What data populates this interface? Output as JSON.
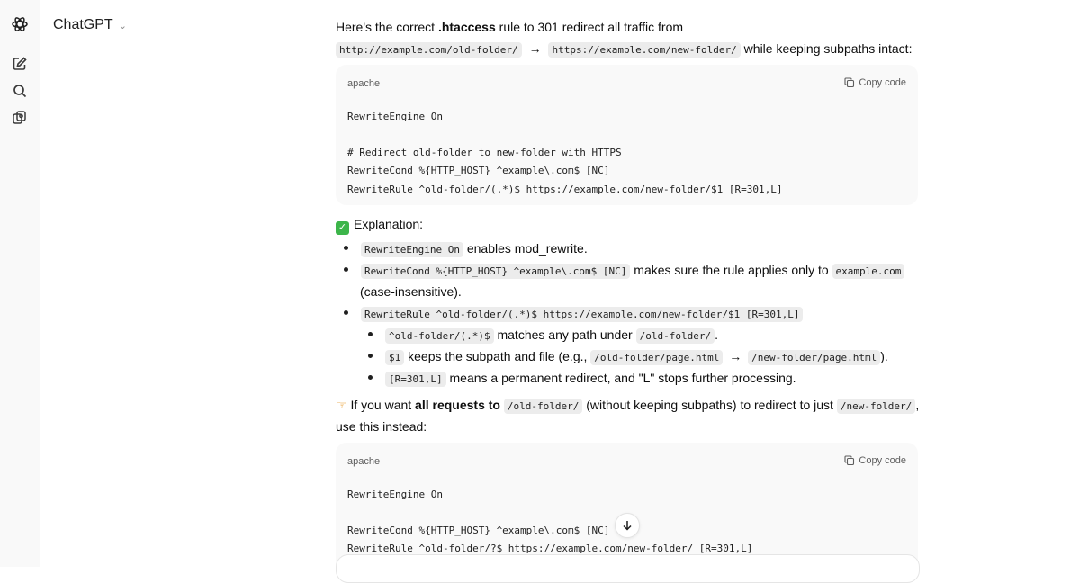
{
  "header": {
    "model_name": "ChatGPT"
  },
  "sidebar": {
    "icons": [
      "openai-logo-icon",
      "new-chat-icon",
      "search-icon",
      "gpts-icon"
    ]
  },
  "message": {
    "intro_1": "Here's the correct ",
    "intro_bold": ".htaccess",
    "intro_2": " rule to 301 redirect all traffic from",
    "from_url": "http://example.com/old-folder/",
    "arrow": "→",
    "to_url": "https://example.com/new-folder/",
    "intro_3": " while keeping subpaths intact:",
    "code1": {
      "lang": "apache",
      "copy_label": "Copy code",
      "lines": [
        "RewriteEngine On",
        "# Redirect old-folder to new-folder with HTTPS",
        "RewriteCond %{HTTP_HOST} ^example\\.com$ [NC]",
        "RewriteRule ^old-folder/(.*)$ https://example.com/new-folder/$1 [R=301,L]"
      ]
    },
    "explanation_heading": "Explanation:",
    "bullets": {
      "b1_code": "RewriteEngine On",
      "b1_text": " enables mod_rewrite.",
      "b2_code": "RewriteCond %{HTTP_HOST} ^example\\.com$ [NC]",
      "b2_text": " makes sure the rule applies only to ",
      "b2_code2": "example.com",
      "b2_text2": "(case-insensitive).",
      "b3_code": "RewriteRule ^old-folder/(.*)$ https://example.com/new-folder/$1 [R=301,L]",
      "s1_code": "^old-folder/(.*)$",
      "s1_text": " matches any path under ",
      "s1_code2": "/old-folder/",
      "s1_end": ".",
      "s2_code": "$1",
      "s2_text": " keeps the subpath and file (e.g., ",
      "s2_code2": "/old-folder/page.html",
      "s2_arrow": "→",
      "s2_code3": "/new-folder/page.html",
      "s2_end": ").",
      "s3_code": "[R=301,L]",
      "s3_text": " means a permanent redirect, and \"L\" stops further processing."
    },
    "tip": {
      "t1": " If you want ",
      "bold": "all requests to",
      "code1": "/old-folder/",
      "t2": " (without keeping subpaths) to redirect to just ",
      "code2": "/new-folder/",
      "t3": ",",
      "line2": "use this instead:"
    },
    "code2": {
      "lang": "apache",
      "copy_label": "Copy code",
      "lines": [
        "RewriteEngine On",
        "RewriteCond %{HTTP_HOST} ^example\\.com$ [NC]",
        "RewriteRule ^old-folder/?$ https://example.com/new-folder/ [R=301,L]"
      ]
    }
  }
}
